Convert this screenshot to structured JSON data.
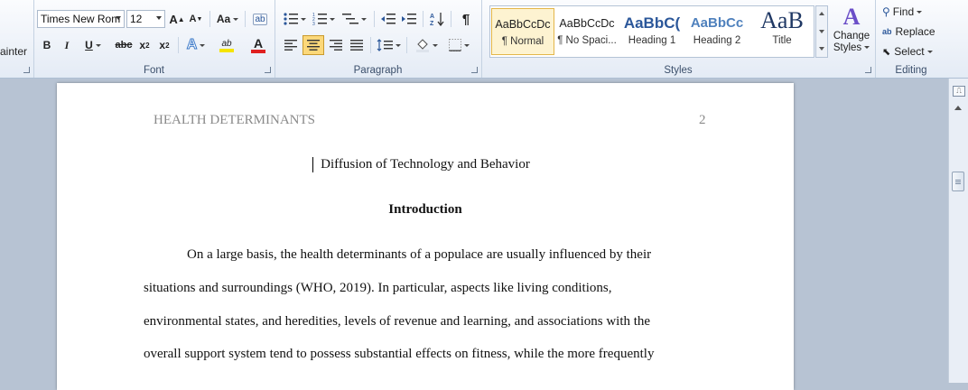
{
  "ribbon": {
    "clipboard": {
      "format_painter": "ainter"
    },
    "font": {
      "label": "Font",
      "font_name": "Times New Rom",
      "font_size": "12",
      "grow": "A",
      "shrink": "A",
      "change_case": "Aa",
      "bold": "B",
      "italic": "I",
      "underline": "U",
      "strikethrough": "abc",
      "subscript": "x",
      "superscript": "x",
      "highlight": "ab",
      "font_color": "A"
    },
    "paragraph": {
      "label": "Paragraph",
      "pilcrow": "¶"
    },
    "styles": {
      "label": "Styles",
      "items": [
        {
          "sample": "AaBbCcDc",
          "name": "¶ Normal"
        },
        {
          "sample": "AaBbCcDc",
          "name": "¶ No Spaci..."
        },
        {
          "sample": "AaBbC(",
          "name": "Heading 1"
        },
        {
          "sample": "AaBbCc",
          "name": "Heading 2"
        },
        {
          "sample": "AaB",
          "name": "Title"
        }
      ],
      "change_styles_line1": "Change",
      "change_styles_line2": "Styles"
    },
    "editing": {
      "label": "Editing",
      "find": "Find",
      "replace": "Replace",
      "select": "Select"
    }
  },
  "document": {
    "running_head": "HEALTH DETERMINANTS",
    "page_number": "2",
    "title": "Diffusion of Technology and Behavior",
    "heading": "Introduction",
    "lines": [
      "On a large basis, the health determinants of a populace are usually influenced by their",
      "situations and surroundings (WHO, 2019). In particular, aspects like living conditions,",
      "environmental states, and heredities, levels of revenue and learning, and associations with the",
      "overall support system tend to possess substantial effects on fitness, while the more frequently"
    ]
  },
  "colors": {
    "highlight": "#f5e400",
    "font_color": "#e02020",
    "accent": "#2b579a"
  }
}
